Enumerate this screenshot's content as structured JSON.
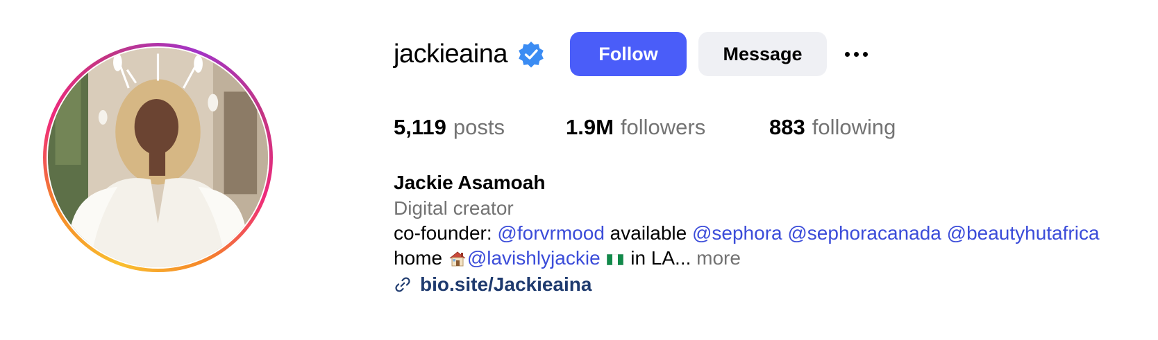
{
  "profile": {
    "username": "jackieaina",
    "verified_icon": "verified-badge-icon",
    "follow_label": "Follow",
    "message_label": "Message",
    "options_icon": "more-options-icon"
  },
  "stats": {
    "posts_count": "5,119",
    "posts_label": "posts",
    "followers_count": "1.9M",
    "followers_label": "followers",
    "following_count": "883",
    "following_label": "following"
  },
  "bio": {
    "full_name": "Jackie Asamoah",
    "category": "Digital creator",
    "line1_prefix": "co-founder: ",
    "mention_forvrmood": "@forvrmood",
    "line1_mid": " available ",
    "mention_sephora": "@sephora",
    "mention_sephoracanada": "@sephoracanada",
    "mention_beautyhutafrica": "@beautyhutafrica",
    "line2_prefix": "home ",
    "mention_lavishlyjackie": "@lavishlyjackie",
    "line2_suffix": " in LA... ",
    "more_label": "more",
    "link_text": "bio.site/Jackieaina"
  },
  "colors": {
    "follow_button": "#4a5df9",
    "message_button": "#eff0f4",
    "mention": "#3b4cd9",
    "link": "#1e3a6e",
    "muted_text": "#737373",
    "verified": "#3b8cf3"
  }
}
